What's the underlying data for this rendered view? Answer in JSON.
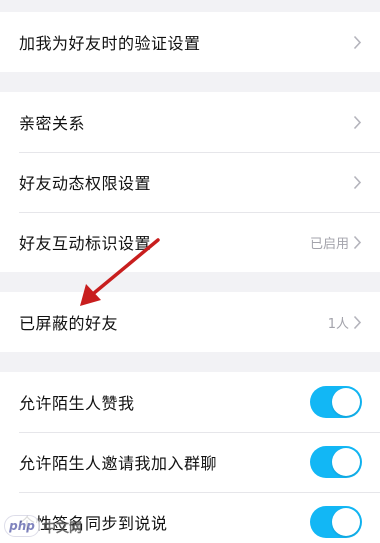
{
  "group1": {
    "rows": [
      {
        "label": "加我为好友时的验证设置"
      }
    ]
  },
  "group2": {
    "rows": [
      {
        "label": "亲密关系"
      },
      {
        "label": "好友动态权限设置"
      },
      {
        "label": "好友互动标识设置",
        "value": "已启用"
      }
    ]
  },
  "group3": {
    "rows": [
      {
        "label": "已屏蔽的好友",
        "value": "1人"
      }
    ]
  },
  "group4": {
    "toggles": [
      {
        "label": "允许陌生人赞我",
        "on": true
      },
      {
        "label": "允许陌生人邀请我加入群聊",
        "on": true
      },
      {
        "label": "个性签名同步到说说",
        "on": true
      }
    ]
  },
  "watermark": {
    "badge": "php",
    "text": "中文网"
  },
  "colors": {
    "toggle_on": "#12b7f5",
    "annotation_arrow": "#c81e1e",
    "secondary_text": "#a3a3ab",
    "background": "#f2f2f5"
  },
  "icons": {
    "disclosure": "chevron-right-icon"
  }
}
